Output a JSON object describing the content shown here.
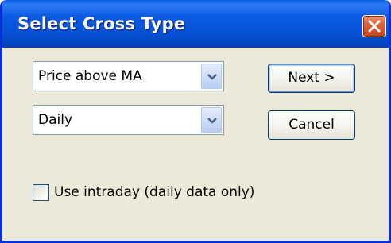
{
  "dialog": {
    "title": "Select Cross Type"
  },
  "cross_type": {
    "selected": "Price above MA"
  },
  "period": {
    "selected": "Daily"
  },
  "buttons": {
    "next_label": "Next >",
    "cancel_label": "Cancel"
  },
  "intraday": {
    "label": "Use intraday (daily data only)",
    "checked": false
  },
  "icons": {
    "close": "close-icon",
    "dropdown": "chevron-down-icon"
  },
  "colors": {
    "titlebar": "#0653d8",
    "close_button": "#d4512a",
    "dialog_background": "#ece9d8",
    "field_border": "#7f9db9"
  }
}
